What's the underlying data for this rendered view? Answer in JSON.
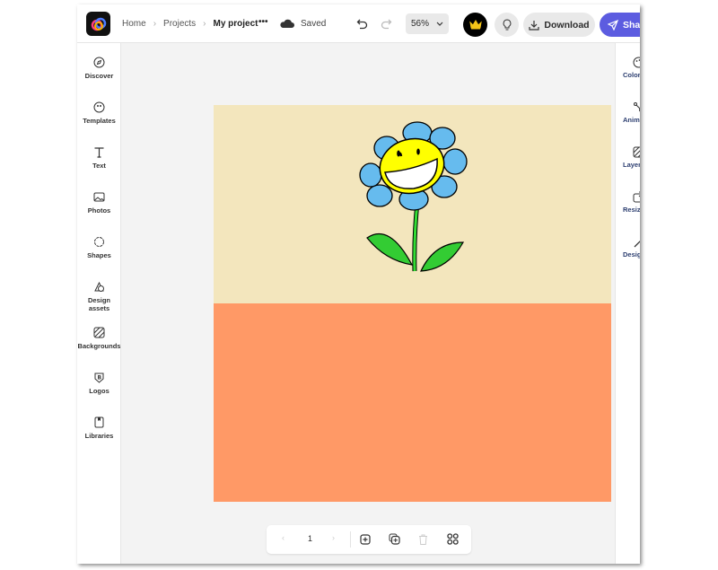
{
  "header": {
    "breadcrumbs": [
      "Home",
      "Projects"
    ],
    "project": "My project",
    "more": "•••",
    "status": "Saved",
    "zoom": "56%",
    "download": "Download",
    "share": "Share"
  },
  "left_sidebar": {
    "items": [
      {
        "label": "Discover"
      },
      {
        "label": "Templates"
      },
      {
        "label": "Text"
      },
      {
        "label": "Photos"
      },
      {
        "label": "Shapes"
      },
      {
        "label": "Design assets"
      },
      {
        "label": "Backgrounds"
      },
      {
        "label": "Logos"
      },
      {
        "label": "Libraries"
      }
    ]
  },
  "right_sidebar": {
    "items": [
      {
        "label": "Colors"
      },
      {
        "label": "Animate"
      },
      {
        "label": "Layers"
      },
      {
        "label": "Resize"
      },
      {
        "label": "Design"
      }
    ]
  },
  "canvas": {
    "top_color": "#f3e6bd",
    "bottom_color": "#ff9966"
  },
  "pager": {
    "page": "1"
  },
  "colors": {
    "accent": "#5c5ce0",
    "premium": "#f5c518"
  }
}
